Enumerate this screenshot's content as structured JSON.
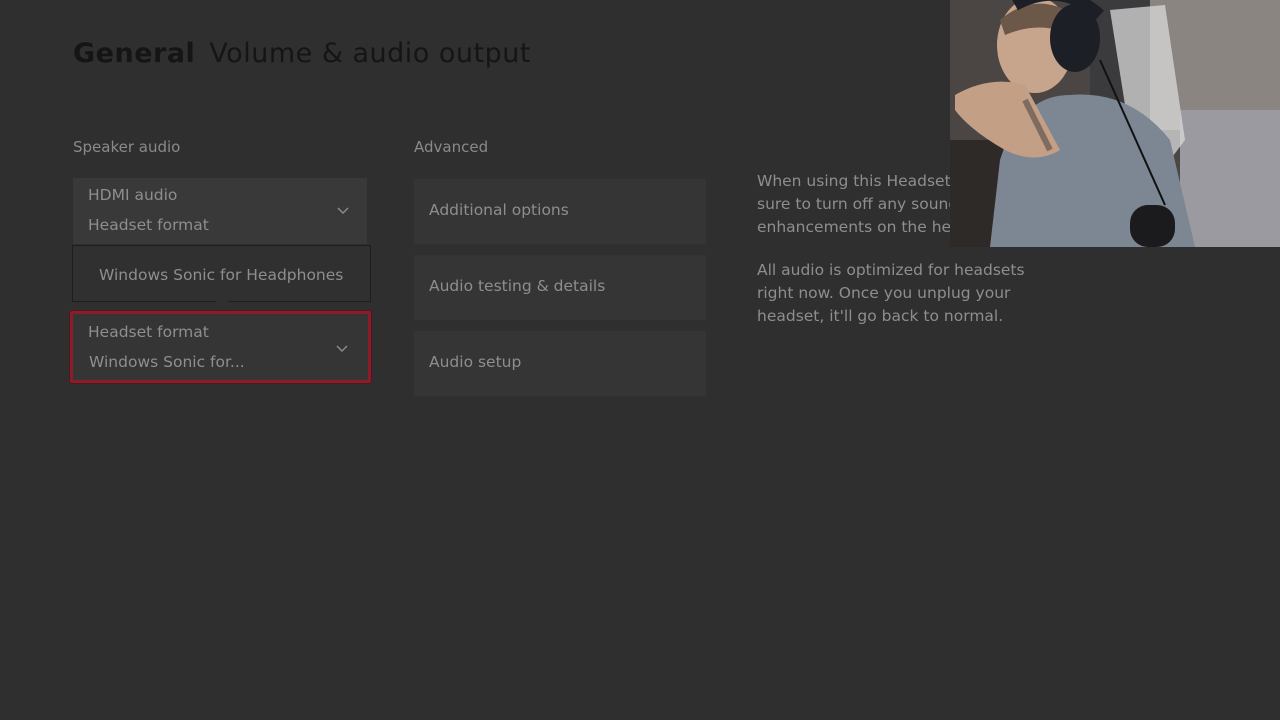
{
  "header": {
    "category": "General",
    "title": "Volume & audio output"
  },
  "speaker_audio": {
    "label": "Speaker audio",
    "output": {
      "line1": "HDMI audio",
      "line2": "Headset format"
    },
    "flyout": {
      "option": "Windows Sonic for Headphones"
    },
    "headset_format": {
      "label": "Headset format",
      "value": "Windows Sonic for..."
    }
  },
  "advanced": {
    "label": "Advanced",
    "items": [
      {
        "label": "Additional options"
      },
      {
        "label": "Audio testing & details"
      },
      {
        "label": "Audio setup"
      }
    ]
  },
  "info": {
    "para1_lines": [
      "When using this Headset",
      "sure to turn off any sound",
      "enhancements on the hea"
    ],
    "para2_lines": [
      "All audio is optimized for headsets",
      "right now. Once you unplug your",
      "headset, it'll go back to normal."
    ]
  },
  "colors": {
    "background": "#2f2f2f",
    "focus_border": "#8c1c2a"
  },
  "icons": [
    "chevron-down-icon"
  ]
}
